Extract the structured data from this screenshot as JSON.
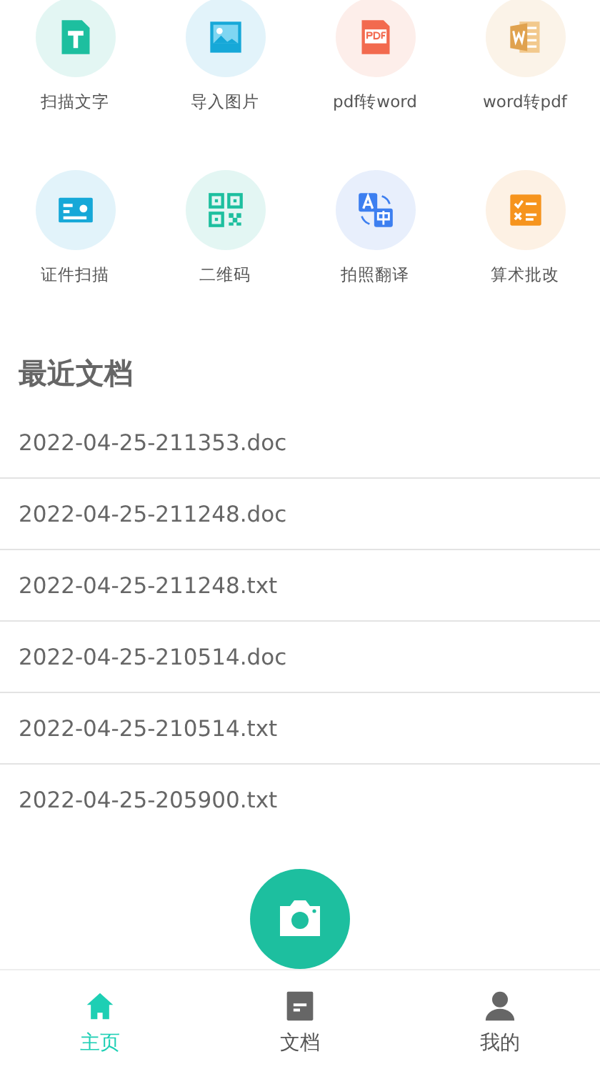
{
  "tools": [
    {
      "kind": "text",
      "label": "扫描文字"
    },
    {
      "kind": "image",
      "label": "导入图片"
    },
    {
      "kind": "pdf",
      "label": "pdf转word"
    },
    {
      "kind": "word",
      "label": "word转pdf"
    },
    {
      "kind": "idcard",
      "label": "证件扫描"
    },
    {
      "kind": "qr",
      "label": "二维码"
    },
    {
      "kind": "translate",
      "label": "拍照翻译"
    },
    {
      "kind": "math",
      "label": "算术批改"
    }
  ],
  "recent": {
    "title": "最近文档",
    "files": [
      "2022-04-25-211353.doc",
      "2022-04-25-211248.doc",
      "2022-04-25-211248.txt",
      "2022-04-25-210514.doc",
      "2022-04-25-210514.txt",
      "2022-04-25-205900.txt"
    ]
  },
  "tabbar": [
    {
      "kind": "home",
      "label": "主页",
      "selected": true
    },
    {
      "kind": "docs",
      "label": "文档",
      "selected": false
    },
    {
      "kind": "me",
      "label": "我的",
      "selected": false
    }
  ]
}
